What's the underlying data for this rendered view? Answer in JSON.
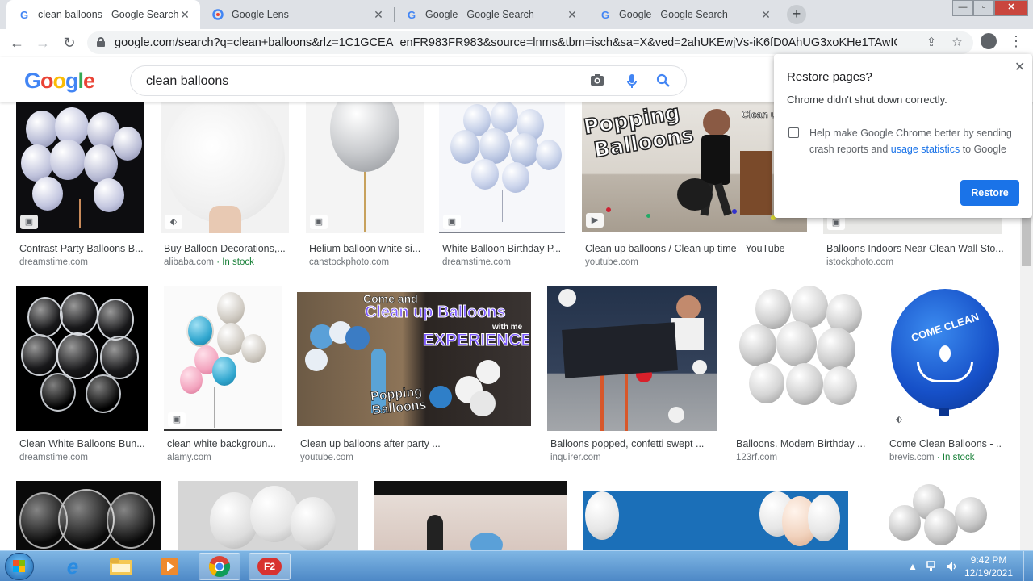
{
  "browser": {
    "tabs": [
      {
        "title": "clean balloons - Google Search",
        "close": "✕",
        "favicon": "google-icon"
      },
      {
        "title": "Google Lens",
        "close": "✕",
        "favicon": "google-lens-icon"
      },
      {
        "title": "Google - Google Search",
        "close": "✕",
        "favicon": "google-icon"
      },
      {
        "title": "Google - Google Search",
        "close": "✕",
        "favicon": "google-icon"
      }
    ],
    "new_tab": "+",
    "window_controls": {
      "minimize": "—",
      "maximize": "▫",
      "close": "✕"
    },
    "url": "google.com/search?q=clean+balloons&rlz=1C1GCEA_enFR983FR983&source=lnms&tbm=isch&sa=X&ved=2ahUKEwjVs-iK6fD0AhUG3xoKHe1TAwIQ_AUoAXo..."
  },
  "google": {
    "logo_letters": [
      "G",
      "o",
      "o",
      "g",
      "l",
      "e"
    ],
    "logo_colors": [
      "#4285f4",
      "#ea4335",
      "#fbbc05",
      "#4285f4",
      "#34a853",
      "#ea4335"
    ],
    "query": "clean balloons"
  },
  "results": [
    {
      "caption": "Contrast Party Balloons B...",
      "source": "dreamstime.com",
      "stock": ""
    },
    {
      "caption": "Buy Balloon Decorations,...",
      "source": "alibaba.com",
      "stock": " · In stock"
    },
    {
      "caption": "Helium balloon white si...",
      "source": "canstockphoto.com",
      "stock": ""
    },
    {
      "caption": "White Balloon Birthday P...",
      "source": "dreamstime.com",
      "stock": ""
    },
    {
      "caption": "Clean up balloons / Clean up time - YouTube",
      "source": "youtube.com",
      "stock": ""
    },
    {
      "caption": "Balloons Indoors Near Clean Wall Sto...",
      "source": "istockphoto.com",
      "stock": ""
    },
    {
      "caption": "Clean White Balloons Bun...",
      "source": "dreamstime.com",
      "stock": ""
    },
    {
      "caption": "clean white backgroun...",
      "source": "alamy.com",
      "stock": ""
    },
    {
      "caption": "Clean up balloons after party ...",
      "source": "youtube.com",
      "stock": ""
    },
    {
      "caption": "Balloons popped, confetti swept ...",
      "source": "inquirer.com",
      "stock": ""
    },
    {
      "caption": "Balloons. Modern Birthday ...",
      "source": "123rf.com",
      "stock": ""
    },
    {
      "caption": "Come Clean Balloons - ...",
      "source": "brevis.com",
      "stock": " · In stock"
    }
  ],
  "image_text": {
    "popping_1": "Popping",
    "popping_2": "Balloons",
    "clean_time": "Clean up Time",
    "come_and": "Come and",
    "clean_up_balloons": "Clean up Balloons",
    "with_me": "with me",
    "experience": "EXPERIENCE",
    "popping_3": "Popping",
    "balloons_3": "Balloons",
    "come_clean": "COME CLEAN"
  },
  "popup": {
    "title": "Restore pages?",
    "message": "Chrome didn't shut down correctly.",
    "help_text": "Help make Google Chrome better by sending crash reports and ",
    "link_text": "usage statistics",
    "help_suffix": " to Google",
    "button": "Restore",
    "close": "✕"
  },
  "taskbar": {
    "time": "9:42 PM",
    "date": "12/19/2021",
    "apps": [
      "start-button",
      "internet-explorer",
      "file-explorer",
      "media-player",
      "chrome",
      "f2-app"
    ]
  }
}
